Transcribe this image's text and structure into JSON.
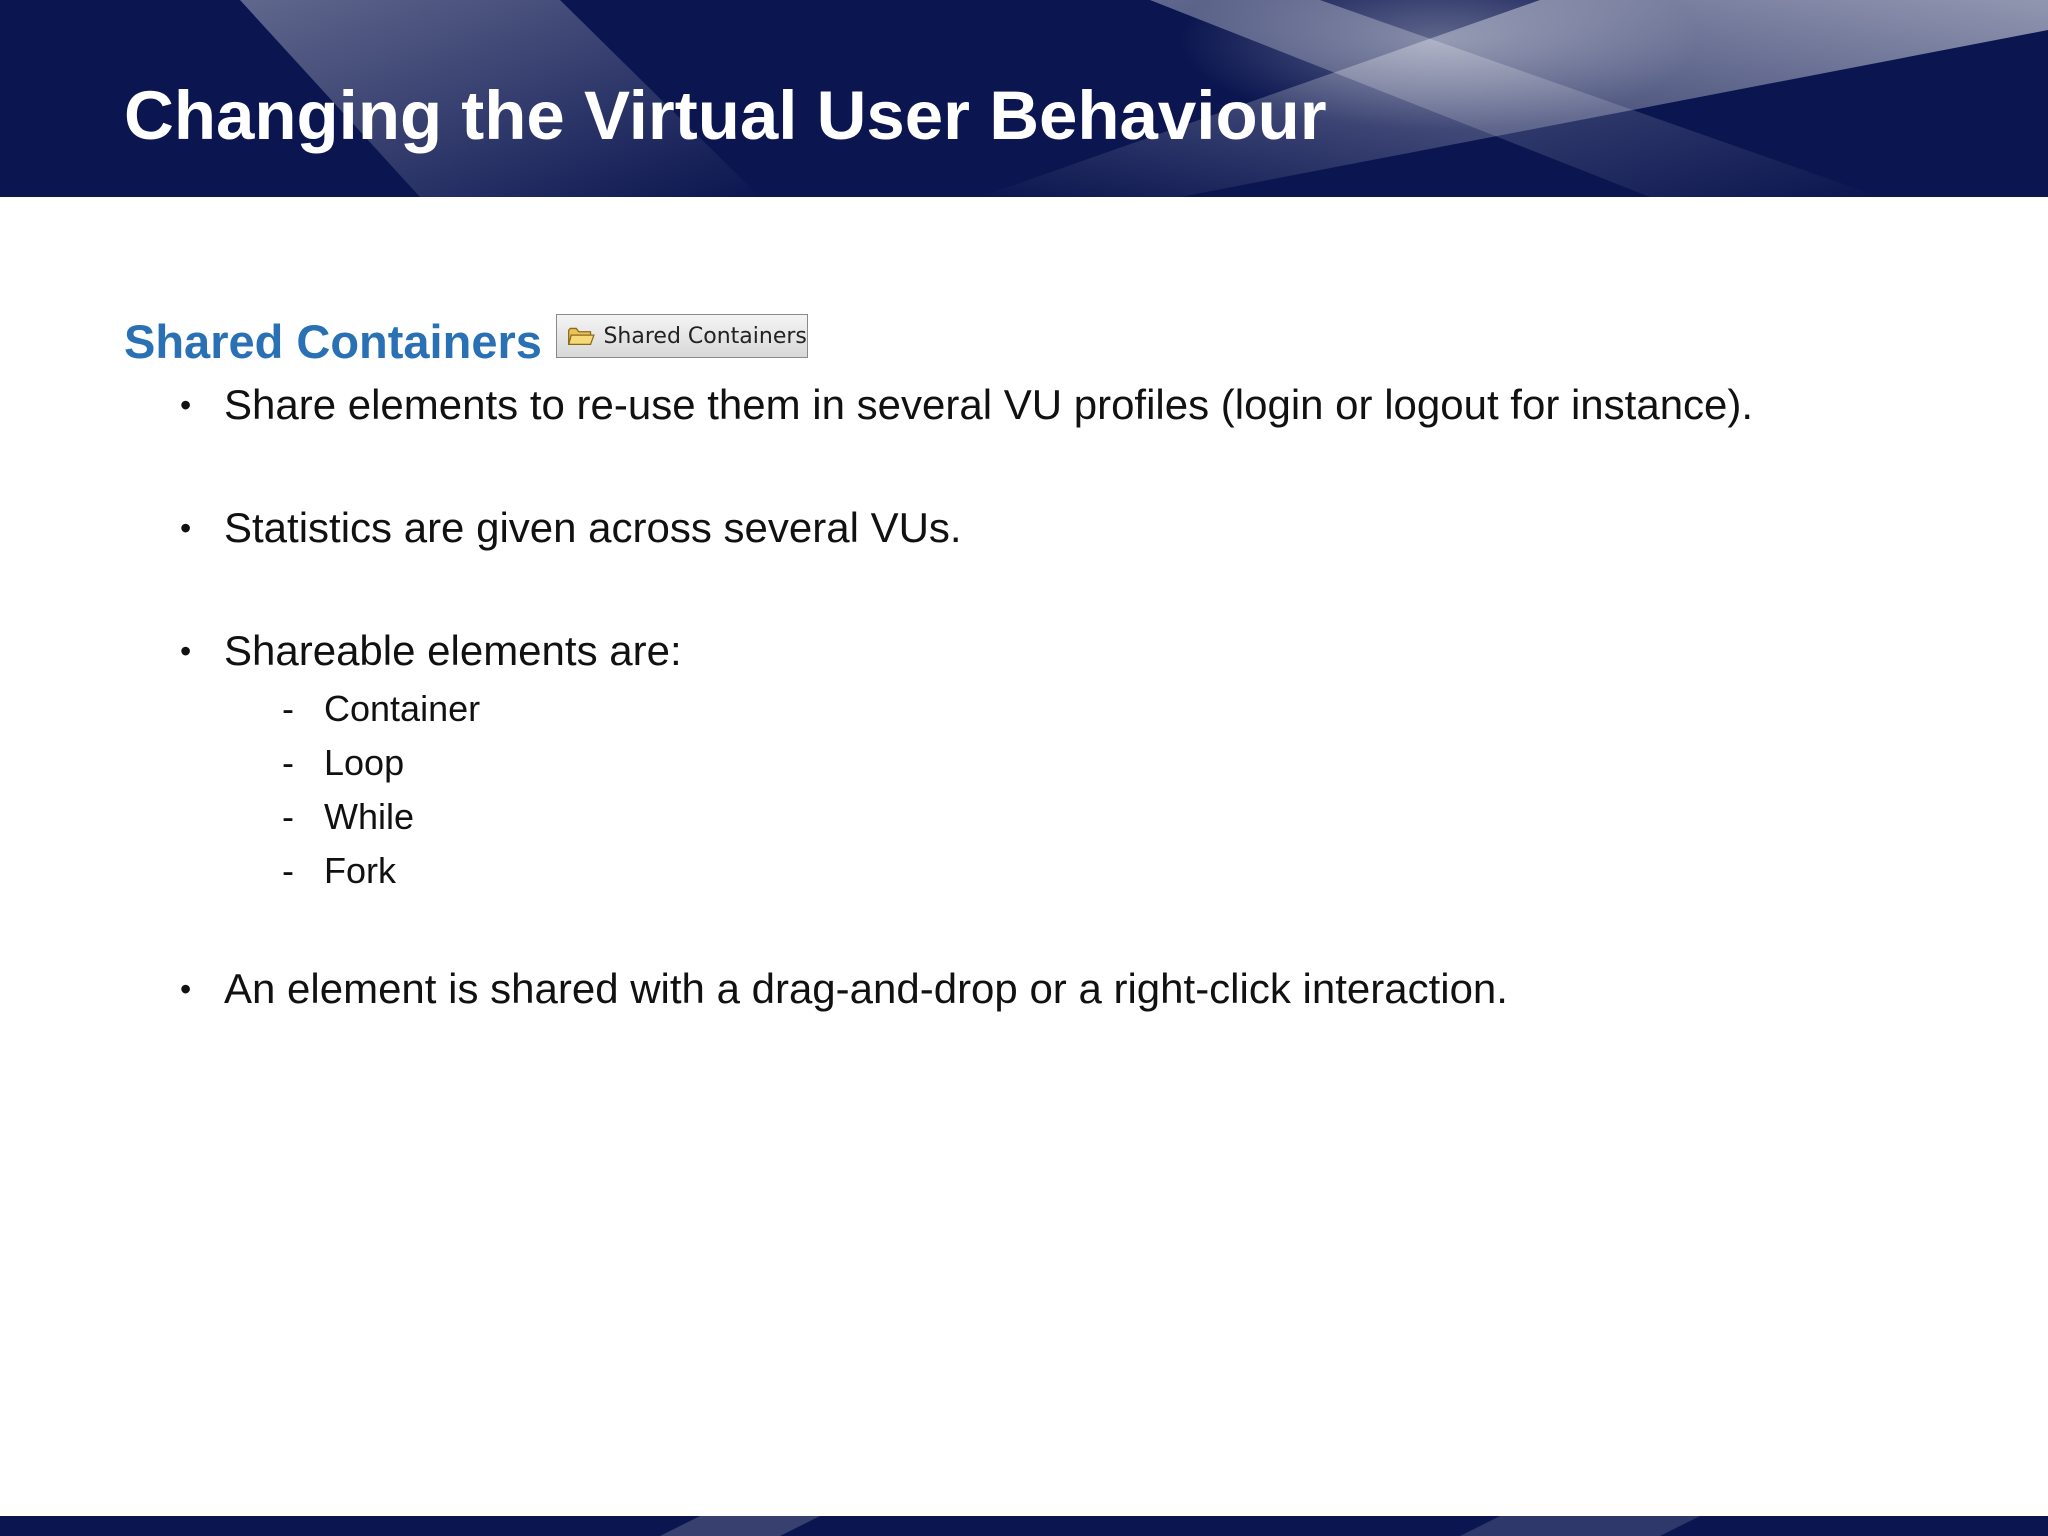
{
  "slide": {
    "title": "Changing the Virtual User Behaviour"
  },
  "section": {
    "title": "Shared Containers",
    "tab_button_label": "Shared Containers",
    "tab_button_icon": "folder-icon"
  },
  "bullets": [
    {
      "text": "Share elements to re-use them in several VU profiles (login or logout for instance)."
    },
    {
      "text": "Statistics are given across several VUs."
    },
    {
      "text": "Shareable elements are:",
      "sub_items": [
        "Container",
        "Loop",
        "While",
        "Fork"
      ]
    },
    {
      "text": "An element is shared with a drag-and-drop or a right-click interaction."
    }
  ],
  "bullet_symbol": "•",
  "sub_symbol": "-",
  "colors": {
    "header_bg": "#0b1650",
    "section_title": "#2a70b5",
    "body_text": "#111111"
  }
}
